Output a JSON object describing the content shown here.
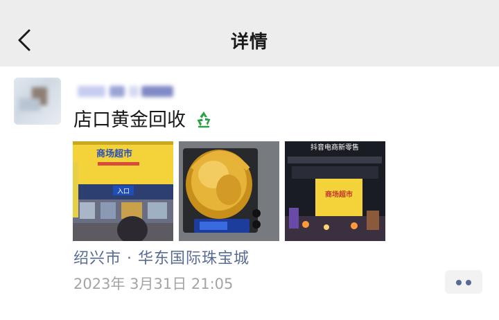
{
  "navbar": {
    "title": "详情",
    "back_icon": "chevron-left-icon"
  },
  "post": {
    "text": "店口黄金回收",
    "emoji": "recycle-icon",
    "images": [
      "photo-storefront",
      "photo-gold-on-scale",
      "photo-night-mall"
    ],
    "location": "绍兴市 · 华东国际珠宝城",
    "timestamp": "2023年 3月31日 21:05"
  },
  "photo_signs": {
    "storefront_sign": "商场超市",
    "storefront_entrance": "入口",
    "night_mall_banner": "抖音电商新零售",
    "night_mall_sign": "商场超市"
  },
  "colors": {
    "link": "#576b95",
    "muted": "#a4a4a4",
    "navbar_bg": "#ededed",
    "sign_yellow": "#f3d23a"
  }
}
